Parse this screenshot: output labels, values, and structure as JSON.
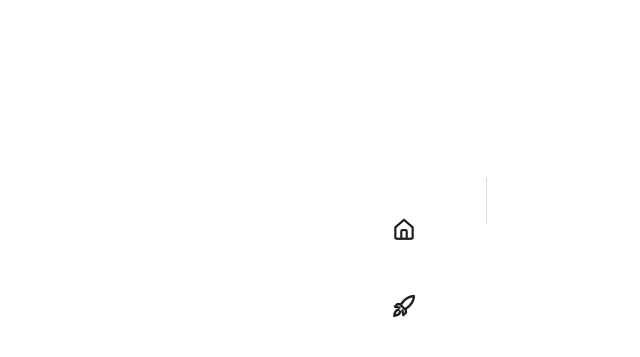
{
  "nav": {
    "items": [
      {
        "id": "home",
        "icon": "house-icon",
        "label": ""
      },
      {
        "id": "launch",
        "icon": "rocket-icon",
        "label": ""
      }
    ]
  },
  "colors": {
    "background": "#ffffff",
    "icon": "#1f1f1f",
    "divider": "#d9d9d9"
  }
}
